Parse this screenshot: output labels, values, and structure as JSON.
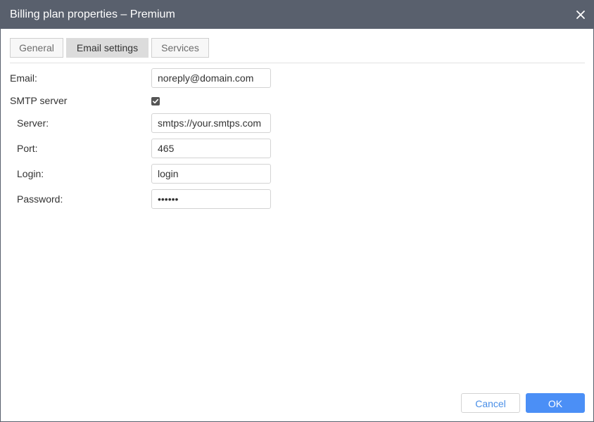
{
  "dialog": {
    "title": "Billing plan properties – Premium"
  },
  "tabs": [
    {
      "label": "General",
      "active": false
    },
    {
      "label": "Email settings",
      "active": true
    },
    {
      "label": "Services",
      "active": false
    }
  ],
  "form": {
    "email_label": "Email:",
    "email_value": "noreply@domain.com",
    "smtp_label": "SMTP server",
    "smtp_checked": true,
    "server_label": "Server:",
    "server_value": "smtps://your.smtps.com",
    "port_label": "Port:",
    "port_value": "465",
    "login_label": "Login:",
    "login_value": "login",
    "password_label": "Password:",
    "password_value": "••••••"
  },
  "buttons": {
    "cancel_label": "Cancel",
    "ok_label": "OK"
  },
  "colors": {
    "titlebar": "#59606d",
    "accent": "#4b8ff6",
    "active_tab": "#dcdcdc"
  },
  "icons": {
    "close": "close-icon",
    "check": "checkmark-icon"
  }
}
